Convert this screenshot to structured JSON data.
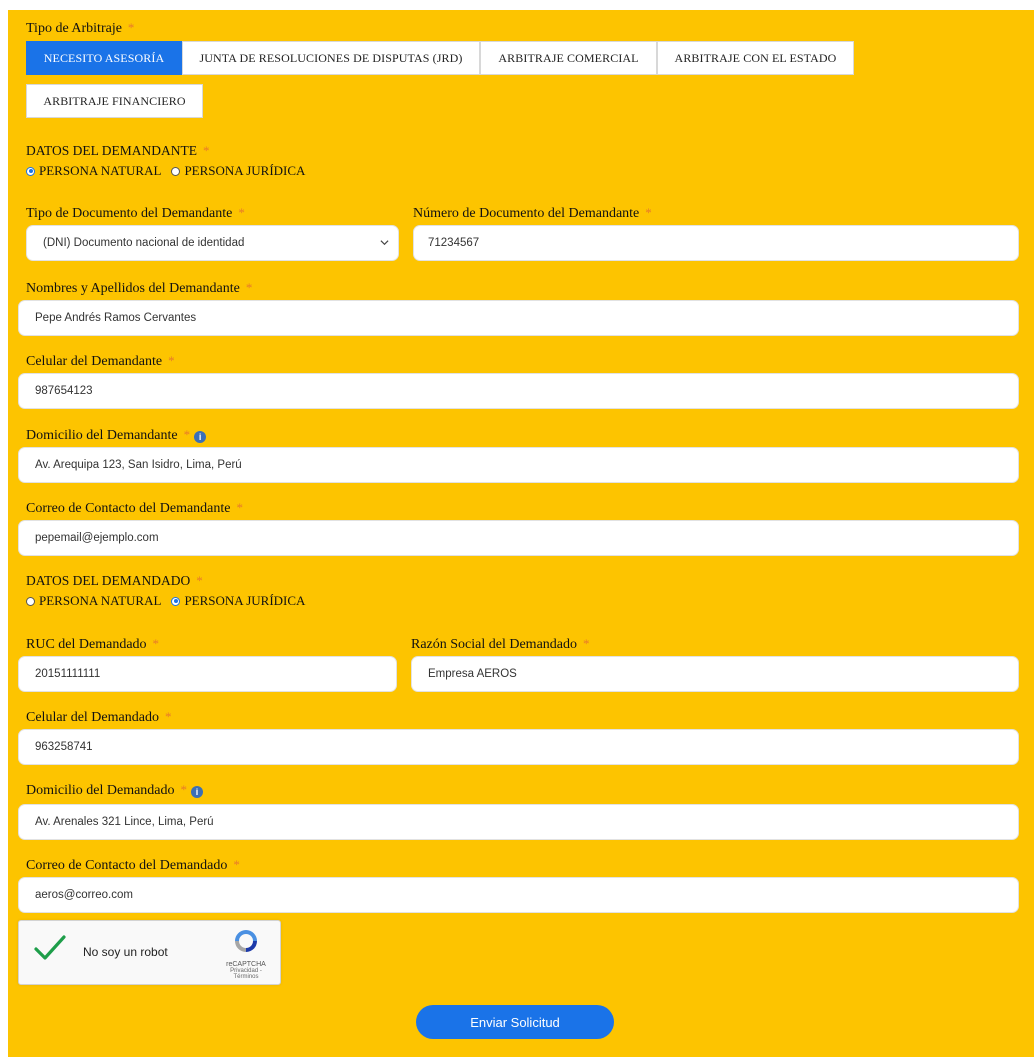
{
  "tipo": {
    "label": "Tipo de Arbitraje",
    "req": "*",
    "tabs": [
      "NECESITO ASESORÍA",
      "JUNTA DE RESOLUCIONES DE DISPUTAS (JRD)",
      "ARBITRAJE COMERCIAL",
      "ARBITRAJE CON EL ESTADO",
      "ARBITRAJE FINANCIERO"
    ]
  },
  "demandante": {
    "heading": "DATOS DEL DEMANDANTE",
    "req": "*",
    "options": [
      "PERSONA NATURAL",
      "PERSONA JURÍDICA"
    ],
    "tipo_doc_label": "Tipo de Documento del Demandante",
    "tipo_doc_value": "(DNI) Documento nacional de identidad",
    "num_doc_label": "Número de Documento del Demandante",
    "num_doc_value": "71234567",
    "nombres_label": "Nombres y Apellidos del Demandante",
    "nombres_value": "Pepe Andrés Ramos Cervantes",
    "celular_label": "Celular del Demandante",
    "celular_value": "987654123",
    "domicilio_label": "Domicilio del Demandante",
    "domicilio_value": "Av. Arequipa 123, San Isidro, Lima, Perú",
    "correo_label": "Correo de Contacto del Demandante",
    "correo_value": "pepemail@ejemplo.com"
  },
  "demandado": {
    "heading": "DATOS DEL DEMANDADO",
    "req": "*",
    "options": [
      "PERSONA NATURAL",
      "PERSONA JURÍDICA"
    ],
    "ruc_label": "RUC del Demandado",
    "ruc_value": "20151111111",
    "razon_label": "Razón Social del Demandado",
    "razon_value": "Empresa AEROS",
    "celular_label": "Celular del Demandado",
    "celular_value": "963258741",
    "domicilio_label": "Domicilio del Demandado",
    "domicilio_value": "Av. Arenales 321 Lince, Lima, Perú",
    "correo_label": "Correo de Contacto del Demandado",
    "correo_value": "aeros@correo.com"
  },
  "captcha": {
    "text": "No soy un robot",
    "brand": "reCAPTCHA",
    "links": "Privacidad - Términos"
  },
  "submit_label": "Enviar Solicitud",
  "colors": {
    "background": "#fdc400",
    "accent": "#1a73e8",
    "required": "#e87a2a",
    "check": "#1e9e4a"
  },
  "icons": {
    "info": "info-icon",
    "select_arrow": "chevron-down-icon",
    "checkmark": "check-icon",
    "recaptcha_logo": "recaptcha-logo-icon"
  }
}
